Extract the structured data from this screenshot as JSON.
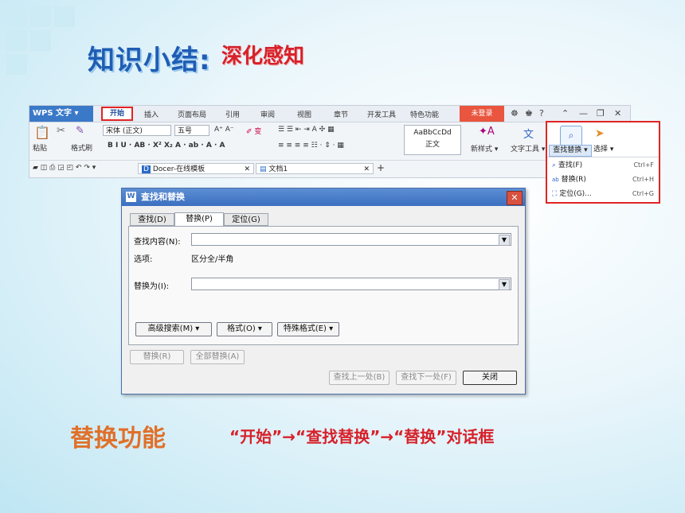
{
  "slide": {
    "title": "知识小结:",
    "subtitle": "深化感知",
    "feature": "替换功能",
    "description": "“开始”→“查找替换”→“替换”对话框"
  },
  "ribbon": {
    "app": "WPS 文字",
    "menus": [
      "插入",
      "页面布局",
      "引用",
      "审阅",
      "视图",
      "章节",
      "开发工具",
      "特色功能"
    ],
    "active_menu": "开始",
    "login": "未登录",
    "paste": "粘贴",
    "format_brush": "格式刷",
    "font": "宋体 (正文)",
    "font_size": "五号",
    "style_sample": "AaBbCcDd",
    "style_name": "正文",
    "new_style": "新样式",
    "text_tools": "文字工具",
    "find_replace": "查找替换",
    "select": "选择",
    "tabs": [
      "Docer-在线模板",
      "文档1"
    ]
  },
  "popup": {
    "items": [
      {
        "label": "查找(F)",
        "key": "Ctrl+F"
      },
      {
        "label": "替换(R)",
        "key": "Ctrl+H"
      },
      {
        "label": "定位(G)...",
        "key": "Ctrl+G"
      }
    ]
  },
  "dialog": {
    "title": "查找和替换",
    "tabs": [
      "查找(D)",
      "替换(P)",
      "定位(G)"
    ],
    "find_label": "查找内容(N):",
    "options_label": "选项:",
    "options_value": "区分全/半角",
    "replace_label": "替换为(I):",
    "btn_advanced": "高级搜索(M) ▾",
    "btn_format": "格式(O) ▾",
    "btn_special": "特殊格式(E) ▾",
    "btn_replace": "替换(R)",
    "btn_replace_all": "全部替换(A)",
    "btn_prev": "查找上一处(B)",
    "btn_next": "查找下一处(F)",
    "btn_close": "关闭"
  }
}
